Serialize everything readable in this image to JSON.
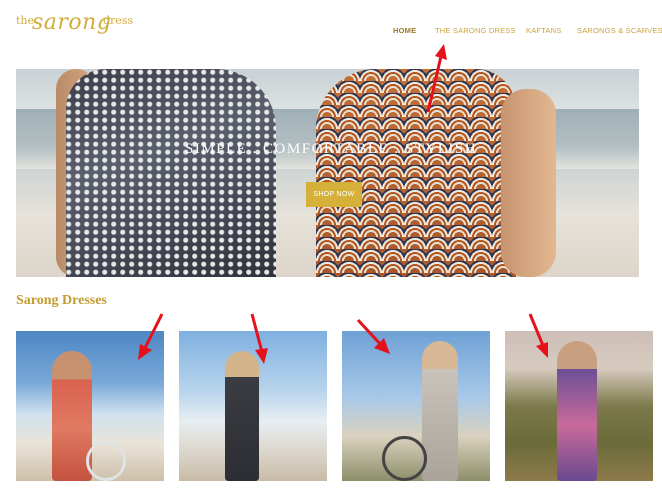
{
  "brand": {
    "logo_the": "the",
    "logo_sarong": "sarong",
    "logo_dress": "dress"
  },
  "nav": {
    "home": "HOME",
    "sarong_dress": "THE SARONG DRESS",
    "kaftans": "KAFTANS",
    "sarongs_scarves": "SARONGS & SCARVES"
  },
  "hero": {
    "title": "SIMPLE . COMFORTABLE . STYLISH",
    "button": "SHOP NOW"
  },
  "section": {
    "title": "Sarong Dresses"
  },
  "products": [
    {
      "name": "coral-sarong-dress-photo"
    },
    {
      "name": "black-print-sarong-dress-photo"
    },
    {
      "name": "grey-sarong-dress-photo"
    },
    {
      "name": "purple-sarong-dress-photo"
    }
  ],
  "colors": {
    "accent": "#d5b13a",
    "nav": "#c9a23a",
    "annotation": "#e5121b"
  }
}
